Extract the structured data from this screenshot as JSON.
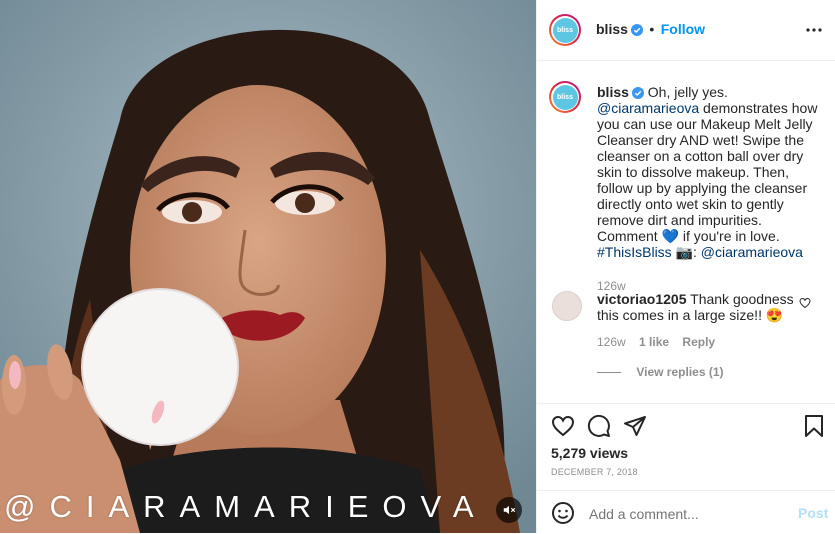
{
  "media": {
    "watermark": "@CIARAMARIEOVA",
    "mute_icon": "speaker-muted-icon",
    "colors": {
      "background": "#7f98a3",
      "hair": "#2a1a14",
      "skin": "#c9906f",
      "lips": "#9c1b22"
    }
  },
  "header": {
    "avatar_text": "bliss",
    "username": "bliss",
    "separator": "•",
    "follow_label": "Follow",
    "more_icon": "more-options-icon"
  },
  "caption": {
    "username": "bliss",
    "text_1": "Oh, jelly yes.",
    "mention_1": "@ciaramarieova",
    "text_2": "demonstrates how you can use our Makeup Melt Jelly Cleanser dry AND wet! Swipe the cleanser on a cotton ball over dry skin to dissolve makeup. Then, follow up by applying the cleanser directly onto wet skin to gently remove dirt and impurities. Comment 💙 if you're in love.",
    "hashtag": "#ThisIsBliss",
    "text_3": "📷:",
    "mention_2": "@ciaramarieova",
    "time": "126w"
  },
  "comment": {
    "username": "victoriao1205",
    "text": "Thank goodness this comes in a large size!! 😍",
    "time": "126w",
    "likes": "1 like",
    "reply_label": "Reply",
    "view_replies": "View replies (1)"
  },
  "actions": {
    "views": "5,279 views",
    "date": "DECEMBER 7, 2018"
  },
  "add_comment": {
    "placeholder": "Add a comment...",
    "post_label": "Post",
    "emoji_icon": "smiley-icon"
  },
  "colors": {
    "accent": "#0095f6",
    "link": "#00376b",
    "muted": "#8e8e8e",
    "border": "#efefef"
  }
}
